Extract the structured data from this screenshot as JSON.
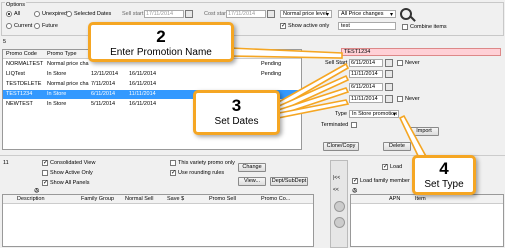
{
  "options": {
    "group_label": "Options",
    "radios": [
      "All",
      "Unexpired",
      "Selected Dates",
      "Current",
      "Future"
    ],
    "sell_start_label": "Sell start",
    "sell_start_value": "17/11/2014",
    "cost_start_label": "Cost start",
    "cost_start_value": "17/11/2014",
    "price_level": "Normal price level",
    "price_changes": "All Price changes",
    "show_active_only": "Show active only",
    "search_value": "test",
    "combine_items": "Combine items"
  },
  "promo_count": "5",
  "promo_table": {
    "headers": [
      "Promo Code",
      "Promo Type",
      "",
      "",
      "",
      ""
    ],
    "rows": [
      {
        "code": "NORMALTEST",
        "type": "Normal price cha...",
        "start": "",
        "end": "",
        "status": "Pending"
      },
      {
        "code": "LIQTest",
        "type": "In Store",
        "start": "12/11/2014",
        "end": "16/11/2014",
        "status": "Pending"
      },
      {
        "code": "TESTDELETE",
        "type": "Normal price chang...",
        "start": "7/11/2014",
        "end": "16/11/2014",
        "status": ""
      },
      {
        "code": "TEST1234",
        "type": "In Store",
        "start": "6/11/2014",
        "end": "11/11/2014",
        "status": ""
      },
      {
        "code": "NEWTEST",
        "type": "In Store",
        "start": "5/11/2014",
        "end": "16/11/2014",
        "status": ""
      }
    ]
  },
  "detail": {
    "promo_name": "TEST1234",
    "sell_start_label": "Sell Start",
    "sell_start": "6/11/2014",
    "date2": "11/11/2014",
    "date3": "6/11/2014",
    "date4": "11/11/2014",
    "never_label": "Never",
    "type_label": "Type",
    "type_value": "In Store promotion",
    "terminated_label": "Terminated",
    "clone_copy": "Clone/Copy",
    "delete": "Delete",
    "import": "Import"
  },
  "lower": {
    "count": "11",
    "consolidated_view": "Consolidated View",
    "show_active_only": "Show Active Only",
    "show_all_panels": "Show All Panels",
    "variety_only": "This variety promo only",
    "use_rounding": "Use rounding rules",
    "change_button": "Change",
    "view_button": "View...",
    "dept_button": "Dept/SubDept",
    "headers": [
      "Description",
      "Family Group",
      "Normal Sell",
      "Save $",
      "Promo Sell",
      "Promo Co..."
    ],
    "load_label": "Load",
    "load_family": "Load family member",
    "apn_header": "APN",
    "item_header": "Item"
  },
  "callouts": [
    {
      "number": "2",
      "text": "Enter Promotion Name"
    },
    {
      "number": "3",
      "text": "Set Dates"
    },
    {
      "number": "4",
      "text": "Set Type"
    }
  ]
}
